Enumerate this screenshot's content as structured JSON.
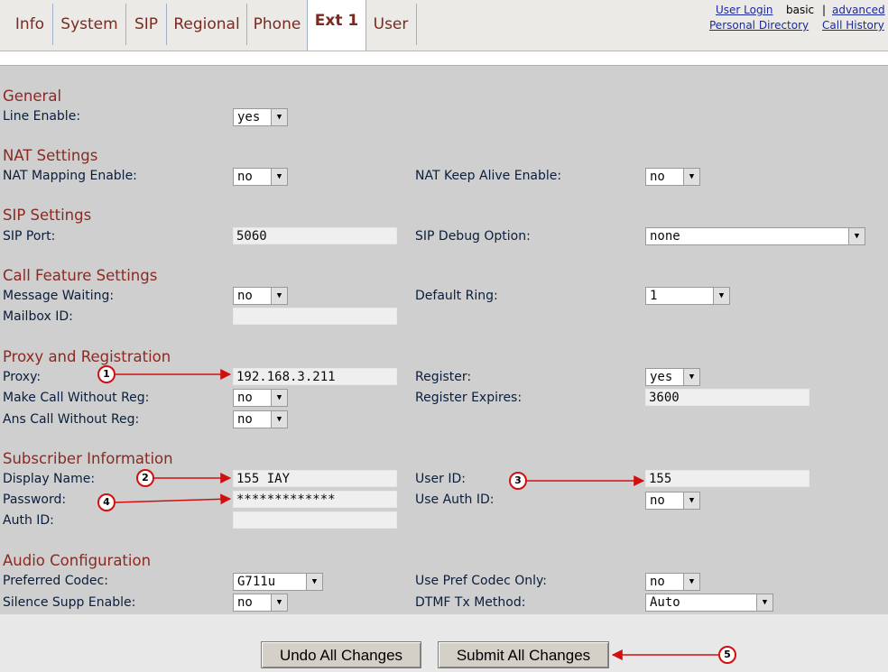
{
  "tabs": [
    "Info",
    "System",
    "SIP",
    "Regional",
    "Phone",
    "Ext 1",
    "User"
  ],
  "active_tab": "Ext 1",
  "top_links": {
    "user_login": "User Login",
    "basic": "basic",
    "separator": "|",
    "advanced": "advanced",
    "personal_directory": "Personal Directory",
    "call_history": "Call History"
  },
  "sections": {
    "general": "General",
    "nat": "NAT Settings",
    "sip": "SIP Settings",
    "call_feature": "Call Feature Settings",
    "proxy": "Proxy and Registration",
    "subscriber": "Subscriber Information",
    "audio": "Audio Configuration"
  },
  "fields": {
    "line_enable": {
      "label": "Line Enable:",
      "value": "yes"
    },
    "nat_mapping_enable": {
      "label": "NAT Mapping Enable:",
      "value": "no"
    },
    "nat_keep_alive_enable": {
      "label": "NAT Keep Alive Enable:",
      "value": "no"
    },
    "sip_port": {
      "label": "SIP Port:",
      "value": "5060"
    },
    "sip_debug_option": {
      "label": "SIP Debug Option:",
      "value": "none"
    },
    "message_waiting": {
      "label": "Message Waiting:",
      "value": "no"
    },
    "default_ring": {
      "label": "Default Ring:",
      "value": "1"
    },
    "mailbox_id": {
      "label": "Mailbox ID:",
      "value": ""
    },
    "proxy": {
      "label": "Proxy:",
      "value": "192.168.3.211"
    },
    "register": {
      "label": "Register:",
      "value": "yes"
    },
    "make_call_without_reg": {
      "label": "Make Call Without Reg:",
      "value": "no"
    },
    "register_expires": {
      "label": "Register Expires:",
      "value": "3600"
    },
    "ans_call_without_reg": {
      "label": "Ans Call Without Reg:",
      "value": "no"
    },
    "display_name": {
      "label": "Display Name:",
      "value": "155 IAY"
    },
    "user_id": {
      "label": "User ID:",
      "value": "155"
    },
    "password": {
      "label": "Password:",
      "value": "*************"
    },
    "use_auth_id": {
      "label": "Use Auth ID:",
      "value": "no"
    },
    "auth_id": {
      "label": "Auth ID:",
      "value": ""
    },
    "preferred_codec": {
      "label": "Preferred Codec:",
      "value": "G711u"
    },
    "use_pref_codec_only": {
      "label": "Use Pref Codec Only:",
      "value": "no"
    },
    "silence_supp_enable": {
      "label": "Silence Supp Enable:",
      "value": "no"
    },
    "dtmf_tx_method": {
      "label": "DTMF Tx Method:",
      "value": "Auto"
    }
  },
  "buttons": {
    "undo": "Undo All Changes",
    "submit": "Submit All Changes"
  },
  "callouts": [
    "1",
    "2",
    "3",
    "4",
    "5"
  ],
  "colors": {
    "section_heading": "#8a2a22",
    "callout": "#d01010",
    "panel": "#cfcfcf"
  }
}
